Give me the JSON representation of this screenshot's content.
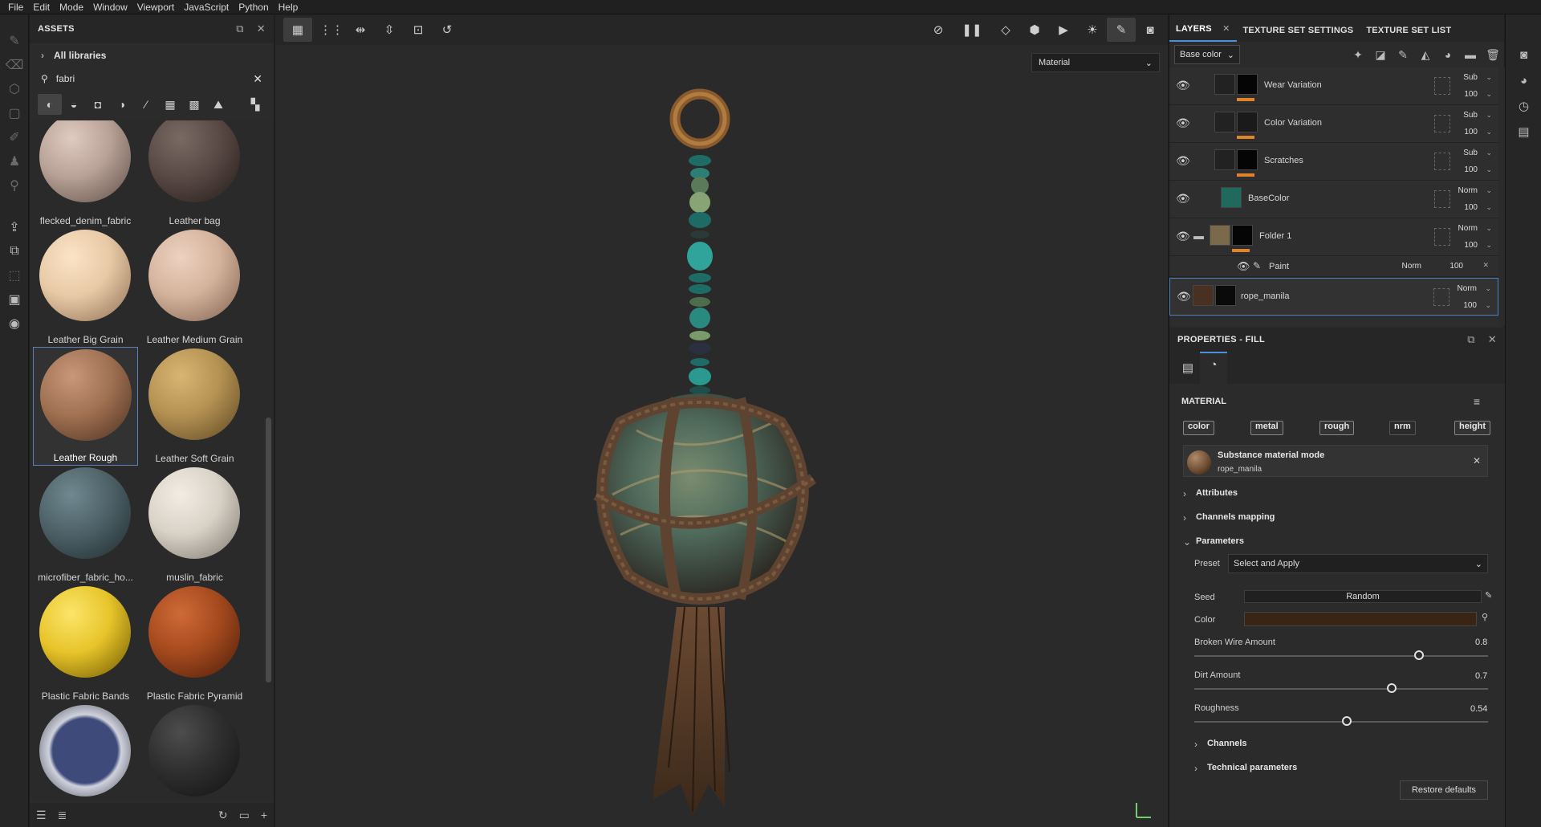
{
  "menu": [
    "File",
    "Edit",
    "Mode",
    "Window",
    "Viewport",
    "JavaScript",
    "Python",
    "Help"
  ],
  "assets": {
    "title": "ASSETS",
    "libraries_label": "All libraries",
    "search_value": "fabri",
    "items": [
      {
        "label": "flecked_denim_fabric",
        "color": "#b8a196"
      },
      {
        "label": "Leather bag",
        "color": "#5a4a45"
      },
      {
        "label": "Leather Big Grain",
        "color": "#e8c9a6"
      },
      {
        "label": "Leather Medium Grain",
        "color": "#d4b39c"
      },
      {
        "label": "Leather Rough",
        "color": "#a07152"
      },
      {
        "label": "Leather Soft Grain",
        "color": "#b59253"
      },
      {
        "label": "microfiber_fabric_ho...",
        "color": "#4d6268"
      },
      {
        "label": "muslin_fabric",
        "color": "#d9d2c7"
      },
      {
        "label": "Plastic Fabric Bands",
        "color": "#e7c42a"
      },
      {
        "label": "Plastic Fabric Pyramid",
        "color": "#a54a1e"
      },
      {
        "label": "",
        "color": "#3e4a7a"
      },
      {
        "label": "",
        "color": "#2f2f2f"
      }
    ]
  },
  "viewport": {
    "material_dropdown": "Material"
  },
  "right": {
    "tabs": [
      {
        "label": "LAYERS"
      },
      {
        "label": "TEXTURE SET SETTINGS"
      },
      {
        "label": "TEXTURE SET LIST"
      }
    ],
    "channel_dropdown": "Base color",
    "layers": [
      {
        "name": "Wear Variation",
        "blend": "Sub",
        "opacity": "100"
      },
      {
        "name": "Color Variation",
        "blend": "Sub",
        "opacity": "100"
      },
      {
        "name": "Scratches",
        "blend": "Sub",
        "opacity": "100"
      },
      {
        "name": "BaseColor",
        "blend": "Norm",
        "opacity": "100"
      },
      {
        "name": "Folder 1",
        "blend": "Norm",
        "opacity": "100"
      },
      {
        "name": "Paint",
        "blend": "Norm",
        "opacity": "100"
      },
      {
        "name": "rope_manila",
        "blend": "Norm",
        "opacity": "100"
      }
    ],
    "top_opacity": "100"
  },
  "properties": {
    "title": "PROPERTIES - FILL",
    "material_label": "MATERIAL",
    "channels": [
      "color",
      "metal",
      "rough",
      "nrm",
      "height"
    ],
    "mode_title": "Substance material mode",
    "mode_material": "rope_manila",
    "attributes": "Attributes",
    "channels_mapping": "Channels mapping",
    "parameters": "Parameters",
    "preset_label": "Preset",
    "preset_value": "Select and Apply",
    "seed_label": "Seed",
    "seed_value": "Random",
    "color_label": "Color",
    "color_swatch": "#3a2515",
    "broken_label": "Broken Wire Amount",
    "broken_value": "0.8",
    "dirt_label": "Dirt Amount",
    "dirt_value": "0.7",
    "rough_label": "Roughness",
    "rough_value": "0.54",
    "channels_sec": "Channels",
    "technical": "Technical parameters",
    "restore": "Restore defaults"
  }
}
